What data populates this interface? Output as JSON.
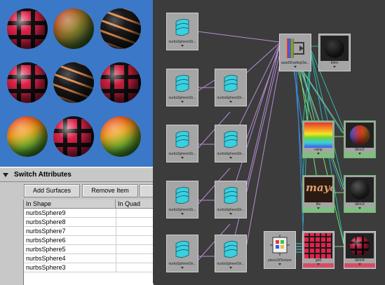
{
  "renders": {
    "spheres": [
      {
        "name": "checker-red",
        "style": "s-check"
      },
      {
        "name": "rgb-gradient",
        "style": "s-rgb"
      },
      {
        "name": "swirl-orange",
        "style": "s-swirl"
      },
      {
        "name": "checker-red",
        "style": "s-check"
      },
      {
        "name": "swirl-orange",
        "style": "s-swirl"
      },
      {
        "name": "checker-red",
        "style": "s-check-dark"
      },
      {
        "name": "ramp-gradient",
        "style": "s-ramp"
      },
      {
        "name": "checker-red",
        "style": "s-check"
      },
      {
        "name": "ramp-gradient",
        "style": "s-ramp"
      }
    ],
    "bg_color": "#3b78c8"
  },
  "switch_panel": {
    "title": "Switch Attributes",
    "buttons": {
      "add": "Add Surfaces",
      "remove": "Remove Item"
    },
    "table": {
      "columns": [
        "In Shape",
        "In Quad"
      ],
      "rows": [
        "nurbsSphere9",
        "nurbsSphere8",
        "nurbsSphere7",
        "nurbsSphere6",
        "nurbsSphere5",
        "nurbsSphere4",
        "nurbsSphere3"
      ]
    }
  },
  "hypershade": {
    "shape_node_label": "nurbsSphereSh...",
    "switch_node_label": "quadShadingSw...",
    "nodes": {
      "blinn1": "blinn",
      "ramp": "ramp",
      "blinn2": "blinn2",
      "file": "file",
      "blinn3": "blinn3",
      "place2d": "place2dTexture",
      "grid": "grid",
      "blinn4": "blinn4"
    },
    "file_texture_text": "maya",
    "wire_colors": {
      "shape": "#b88cd8",
      "shader": "#2fb8a8",
      "selected": "#7fe06f"
    }
  }
}
